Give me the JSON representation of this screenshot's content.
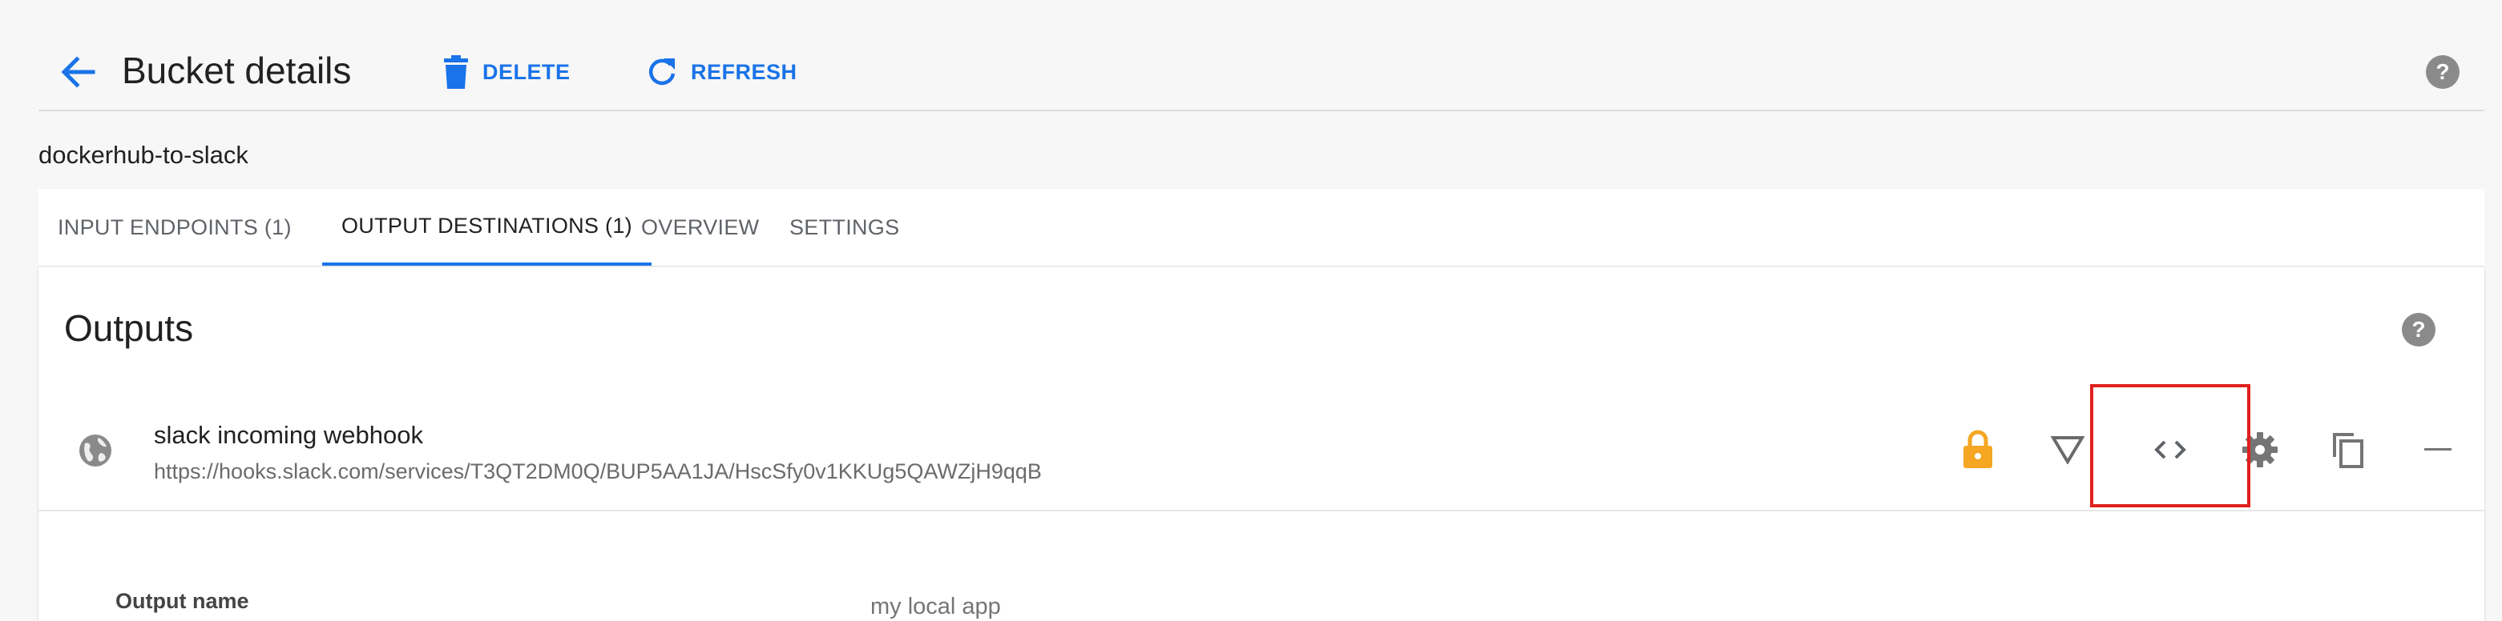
{
  "header": {
    "title": "Bucket details",
    "delete_label": "DELETE",
    "refresh_label": "REFRESH"
  },
  "bucket": {
    "name": "dockerhub-to-slack"
  },
  "tabs": [
    {
      "label": "INPUT ENDPOINTS (1)",
      "active": false
    },
    {
      "label": "OUTPUT DESTINATIONS (1)",
      "active": true
    },
    {
      "label": "OVERVIEW",
      "active": false
    },
    {
      "label": "SETTINGS",
      "active": false
    }
  ],
  "outputs": {
    "title": "Outputs",
    "items": [
      {
        "name": "slack incoming webhook",
        "url": "https://hooks.slack.com/services/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"
      }
    ]
  },
  "form": {
    "output_name_label": "Output name",
    "output_name_placeholder": "my local app"
  },
  "icons": {
    "back": "arrow-left-icon",
    "delete": "trash-icon",
    "refresh": "refresh-icon",
    "help": "help-circle-icon",
    "globe": "globe-icon",
    "lock": "lock-icon",
    "filter": "filter-triangle-icon",
    "code": "code-brackets-icon",
    "settings": "gear-icon",
    "copy": "copy-icon",
    "remove": "minus-icon"
  },
  "colors": {
    "accent": "#1a73e8",
    "lock": "#f5a623",
    "highlight": "#e0201c",
    "icon_grey": "#757575"
  }
}
